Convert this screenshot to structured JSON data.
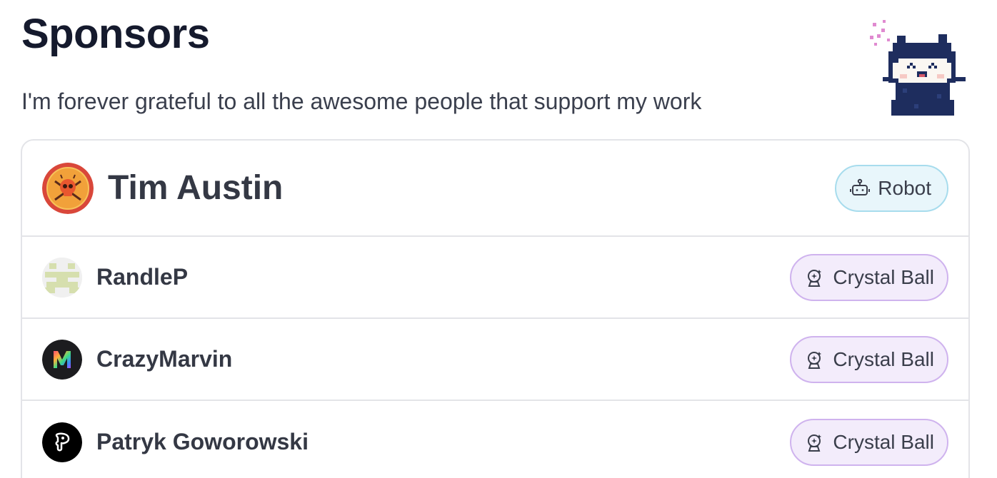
{
  "header": {
    "title": "Sponsors",
    "subtitle": "I'm forever grateful to all the awesome people that support my work"
  },
  "mascot": {
    "icon": "pixel-cat-mascot-icon"
  },
  "sponsors": [
    {
      "name": "Tim Austin",
      "tier": "Robot",
      "tier_icon": "robot-icon",
      "avatar_icon": "skull-crossbones-avatar"
    },
    {
      "name": "RandleP",
      "tier": "Crystal Ball",
      "tier_icon": "crystal-ball-icon",
      "avatar_icon": "identicon-avatar"
    },
    {
      "name": "CrazyMarvin",
      "tier": "Crystal Ball",
      "tier_icon": "crystal-ball-icon",
      "avatar_icon": "rainbow-m-avatar"
    },
    {
      "name": "Patryk Goworowski",
      "tier": "Crystal Ball",
      "tier_icon": "crystal-ball-icon",
      "avatar_icon": "p-logo-avatar"
    }
  ],
  "colors": {
    "robot_badge_bg": "#e8f6fb",
    "robot_badge_border": "#a7dced",
    "crystal_badge_bg": "#f3ecfb",
    "crystal_badge_border": "#cfb3ee"
  }
}
